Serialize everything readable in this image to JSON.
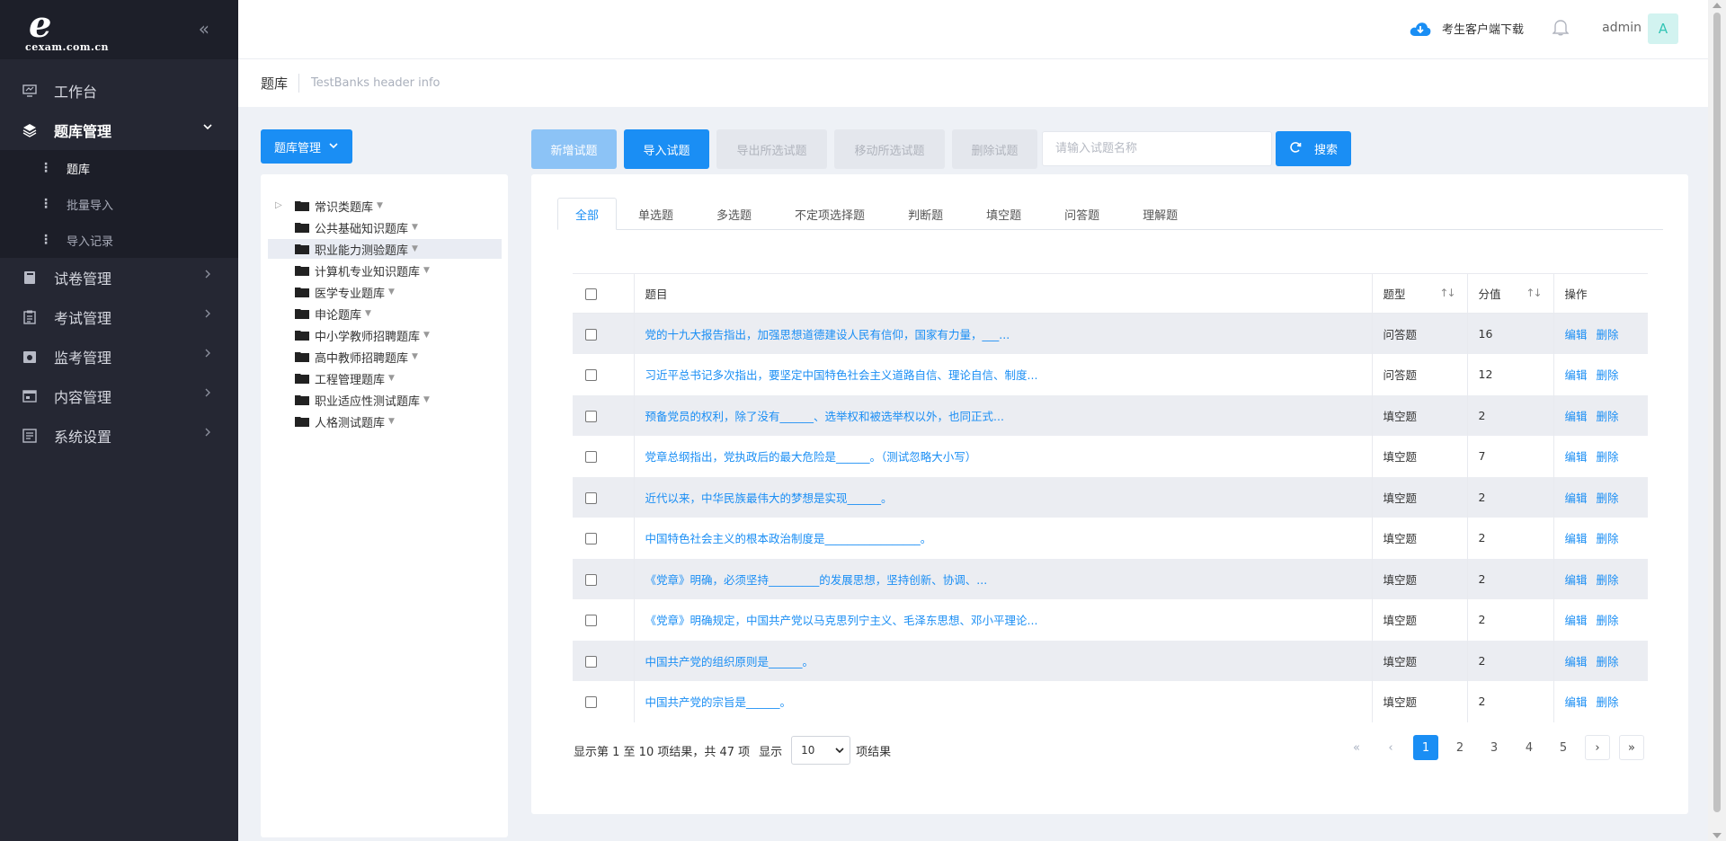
{
  "brand": {
    "mark": "e",
    "domain": "cexam.com.cn"
  },
  "sidebar": {
    "collapse": "«",
    "items": [
      {
        "label": "工作台"
      },
      {
        "label": "题库管理",
        "sub": [
          "题库",
          "批量导入",
          "导入记录"
        ]
      },
      {
        "label": "试卷管理"
      },
      {
        "label": "考试管理"
      },
      {
        "label": "监考管理"
      },
      {
        "label": "内容管理"
      },
      {
        "label": "系统设置"
      }
    ]
  },
  "header": {
    "download": "考生客户端下载",
    "username": "admin",
    "avatar": "A"
  },
  "crumb": {
    "title": "题库",
    "info": "TestBanks header info"
  },
  "tree": {
    "button": "题库管理",
    "nodes": [
      "常识类题库",
      "公共基础知识题库",
      "职业能力测验题库",
      "计算机专业知识题库",
      "医学专业题库",
      "申论题库",
      "中小学教师招聘题库",
      "高中教师招聘题库",
      "工程管理题库",
      "职业适应性测试题库",
      "人格测试题库"
    ]
  },
  "toolbar": {
    "add": "新增试题",
    "import": "导入试题",
    "export": "导出所选试题",
    "move": "移动所选试题",
    "delete": "删除试题",
    "search_placeholder": "请输入试题名称",
    "search": "搜索"
  },
  "tabs": [
    "全部",
    "单选题",
    "多选题",
    "不定项选择题",
    "判断题",
    "填空题",
    "问答题",
    "理解题"
  ],
  "table": {
    "headers": {
      "title": "题目",
      "type": "题型",
      "score": "分值",
      "ops": "操作"
    },
    "edit": "编辑",
    "remove": "删除",
    "rows": [
      {
        "title": "党的十九大报告指出，加强思想道德建设人民有信仰，国家有力量，___...",
        "type": "问答题",
        "score": "16"
      },
      {
        "title": "习近平总书记多次指出，要坚定中国特色社会主义道路自信、理论自信、制度...",
        "type": "问答题",
        "score": "12"
      },
      {
        "title": "预备党员的权利，除了没有______、选举权和被选举权以外，也同正式...",
        "type": "填空题",
        "score": "2"
      },
      {
        "title": "党章总纲指出，党执政后的最大危险是______。（测试忽略大小写）",
        "type": "填空题",
        "score": "7"
      },
      {
        "title": "近代以来，中华民族最伟大的梦想是实现______。",
        "type": "填空题",
        "score": "2"
      },
      {
        "title": "中国特色社会主义的根本政治制度是_________________。",
        "type": "填空题",
        "score": "2"
      },
      {
        "title": "《党章》明确，必须坚持_________的发展思想，坚持创新、协调、...",
        "type": "填空题",
        "score": "2"
      },
      {
        "title": "《党章》明确规定，中国共产党以马克思列宁主义、毛泽东思想、邓小平理论...",
        "type": "填空题",
        "score": "2"
      },
      {
        "title": "中国共产党的组织原则是______。",
        "type": "填空题",
        "score": "2"
      },
      {
        "title": "中国共产党的宗旨是______。",
        "type": "填空题",
        "score": "2"
      }
    ]
  },
  "footer": {
    "info": "显示第 1 至 10 项结果，共 47 项",
    "show": "显示",
    "page_size": "10",
    "results": "项结果"
  },
  "pagination": {
    "first": "«",
    "prev": "‹",
    "pages": [
      "1",
      "2",
      "3",
      "4",
      "5"
    ],
    "next": "›",
    "last": "»",
    "current": "1"
  },
  "colors": {
    "primary": "#1a8ef4",
    "sidebar": "#252733",
    "avatar_bg": "#d2f3f0"
  }
}
